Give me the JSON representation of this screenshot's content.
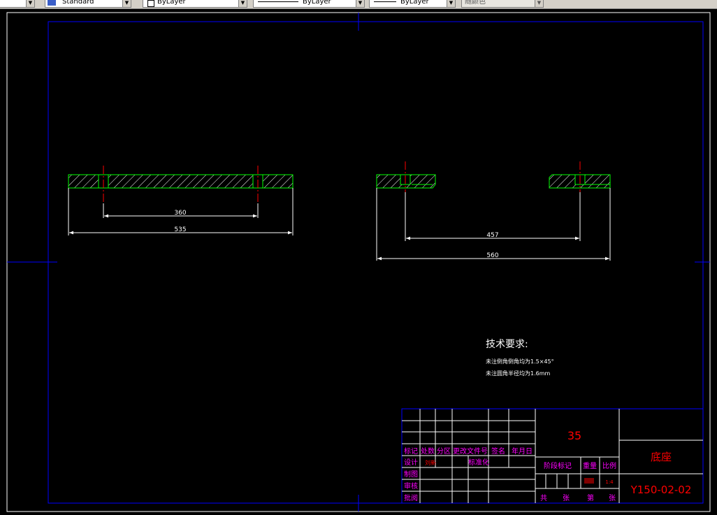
{
  "toolbar": {
    "text_style": "Standard",
    "layer_color": "ByLayer",
    "linetype": "ByLayer",
    "lineweight": "ByLayer",
    "plot_style": "随颜色"
  },
  "drawing": {
    "view1": {
      "dim_inner": "360",
      "dim_outer": "535"
    },
    "view2": {
      "dim_inner": "457",
      "dim_outer": "560"
    },
    "tech": {
      "heading": "技术要求:",
      "line1": "未注倒角倒角均为1.5×45°",
      "line2": "未注圆角半径均为1.6mm"
    },
    "title_block": {
      "material": "35",
      "part_name": "底座",
      "drawing_no": "Y150-02-02",
      "h_mark": "标记",
      "h_count": "处数",
      "h_zone": "分区",
      "h_doc": "更改文件号",
      "h_sign": "签名",
      "h_date": "年月日",
      "r_design": "设计",
      "r_design_name": "刘新",
      "r_std": "标准化",
      "r_draw": "制图",
      "r_check": "审核",
      "r_approve": "批阅",
      "stage_mark": "阶段标记",
      "weight": "重量",
      "scale": "比例",
      "weight_val": "",
      "scale_val": "1:4",
      "total": "共",
      "sheets": "张",
      "nth": "第",
      "sheet2": "张"
    }
  },
  "colors": {
    "outline": "#00ff00",
    "center": "#ff0000",
    "dim": "#ffffff",
    "frame": "#0000ff",
    "label": "#ff00ff"
  }
}
